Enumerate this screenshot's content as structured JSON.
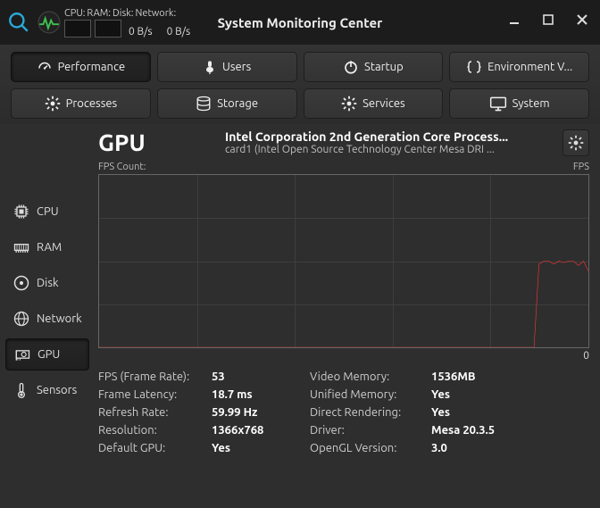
{
  "panel": {
    "labels": {
      "cpu": "CPU:",
      "ram": "RAM:",
      "disk": "Disk:",
      "net": "Network:"
    },
    "disk_rate": "0 B/s",
    "net_rate": "0 B/s"
  },
  "window_title": "System Monitoring Center",
  "top_buttons_row1": [
    {
      "id": "performance",
      "label": "Performance",
      "active": true
    },
    {
      "id": "users",
      "label": "Users"
    },
    {
      "id": "startup",
      "label": "Startup"
    },
    {
      "id": "env",
      "label": "Environment V..."
    }
  ],
  "top_buttons_row2": [
    {
      "id": "processes",
      "label": "Processes"
    },
    {
      "id": "storage",
      "label": "Storage"
    },
    {
      "id": "services",
      "label": "Services"
    },
    {
      "id": "system",
      "label": "System"
    }
  ],
  "sidebar": {
    "items": [
      {
        "id": "cpu",
        "label": "CPU"
      },
      {
        "id": "ram",
        "label": "RAM"
      },
      {
        "id": "disk",
        "label": "Disk"
      },
      {
        "id": "network",
        "label": "Network"
      },
      {
        "id": "gpu",
        "label": "GPU",
        "active": true
      },
      {
        "id": "sensors",
        "label": "Sensors"
      }
    ]
  },
  "gpu": {
    "title": "GPU",
    "device_line1": "Intel Corporation 2nd Generation Core Process...",
    "device_line2": "card1 (Intel Open Source Technology Center Mesa DRI ...",
    "chart_left_label": "FPS Count:",
    "chart_right_label": "FPS",
    "chart_zero": "0"
  },
  "stats_left": [
    {
      "label": "FPS (Frame Rate):",
      "value": "53"
    },
    {
      "label": "Frame Latency:",
      "value": "18.7 ms"
    },
    {
      "label": "Refresh Rate:",
      "value": "59.99 Hz"
    },
    {
      "label": "Resolution:",
      "value": "1366x768"
    },
    {
      "label": "Default GPU:",
      "value": "Yes"
    }
  ],
  "stats_right": [
    {
      "label": "Video Memory:",
      "value": "1536MB"
    },
    {
      "label": "Unified Memory:",
      "value": "Yes"
    },
    {
      "label": "Direct Rendering:",
      "value": "Yes"
    },
    {
      "label": "Driver:",
      "value": "Mesa 20.3.5"
    },
    {
      "label": "OpenGL Version:",
      "value": "3.0"
    }
  ],
  "chart_data": {
    "type": "line",
    "title": "FPS Count",
    "ylabel": "FPS",
    "ylim": [
      0,
      120
    ],
    "series": [
      {
        "name": "fps",
        "color": "#ff3333",
        "values": [
          0,
          0,
          0,
          0,
          0,
          0,
          0,
          0,
          0,
          0,
          0,
          0,
          0,
          0,
          0,
          0,
          0,
          0,
          0,
          0,
          0,
          0,
          0,
          0,
          0,
          0,
          0,
          0,
          0,
          0,
          0,
          0,
          0,
          0,
          0,
          0,
          0,
          0,
          0,
          0,
          0,
          0,
          0,
          0,
          0,
          0,
          0,
          0,
          0,
          0,
          0,
          0,
          0,
          0,
          0,
          0,
          0,
          0,
          0,
          0,
          0,
          0,
          0,
          0,
          0,
          0,
          0,
          0,
          0,
          0,
          0,
          0,
          0,
          0,
          0,
          0,
          0,
          0,
          0,
          0,
          0,
          0,
          0,
          0,
          0,
          0,
          0,
          0,
          0,
          58,
          60,
          60,
          58,
          60,
          59,
          60,
          60,
          57,
          60,
          53
        ]
      }
    ]
  }
}
